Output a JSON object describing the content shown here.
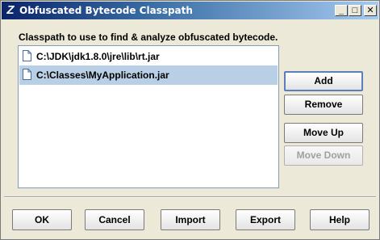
{
  "window": {
    "title": "Obfuscated Bytecode Classpath",
    "app_icon": "Z",
    "minimize_glyph": "_",
    "maximize_glyph": "□",
    "close_glyph": "✕"
  },
  "caption": "Classpath to use to find & analyze obfuscated bytecode.",
  "classpath": {
    "entries": [
      {
        "path": "C:\\JDK\\jdk1.8.0\\jre\\lib\\rt.jar",
        "selected": false
      },
      {
        "path": "C:\\Classes\\MyApplication.jar",
        "selected": true
      }
    ]
  },
  "side_buttons": {
    "add": "Add",
    "remove": "Remove",
    "move_up": "Move Up",
    "move_down": "Move Down"
  },
  "bottom_buttons": {
    "ok": "OK",
    "cancel": "Cancel",
    "import": "Import",
    "export": "Export",
    "help": "Help"
  },
  "colors": {
    "selection": "#b8cfe5",
    "title_gradient_start": "#0a246a",
    "title_gradient_end": "#a6caf0"
  },
  "icons": {
    "entry_icon": "file-icon"
  }
}
